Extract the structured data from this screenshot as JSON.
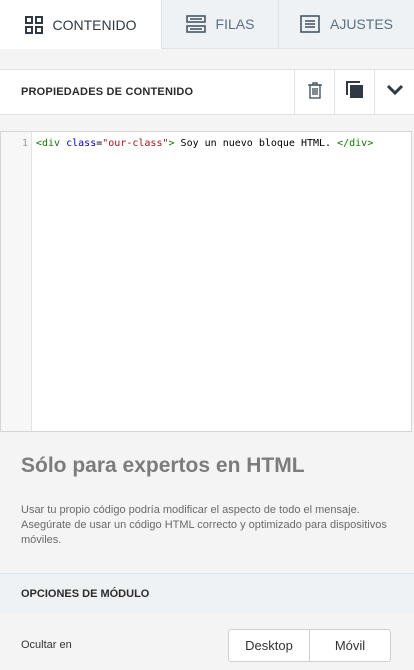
{
  "tabs": [
    {
      "label": "CONTENIDO",
      "icon": "grid-icon",
      "active": true
    },
    {
      "label": "FILAS",
      "icon": "rows-icon",
      "active": false
    },
    {
      "label": "AJUSTES",
      "icon": "settings-list-icon",
      "active": false
    }
  ],
  "properties": {
    "title": "PROPIEDADES DE CONTENIDO",
    "actions": [
      "trash-icon",
      "duplicate-icon",
      "chevron-down-icon"
    ]
  },
  "editor": {
    "line_number": "1",
    "code": {
      "open_tag": "<div",
      "attr": "class",
      "eq": "=",
      "value": "\"our-class\"",
      "close_open": ">",
      "text": " Soy un nuevo bloque HTML. ",
      "close_tag": "</div>"
    }
  },
  "warning": {
    "title": "Sólo para expertos en HTML",
    "text": "Usar tu propio código podría modificar el aspecto de todo el mensaje. Asegúrate de usar un código HTML correcto y optimizado para dispositivos móviles."
  },
  "module": {
    "title": "OPCIONES DE MÓDULO",
    "hide_label": "Ocultar en",
    "options": [
      "Desktop",
      "Móvil"
    ]
  },
  "colors": {
    "tab_bg": "#eef2f4",
    "active_tab_bg": "#ffffff",
    "icon": "#4a5866"
  }
}
